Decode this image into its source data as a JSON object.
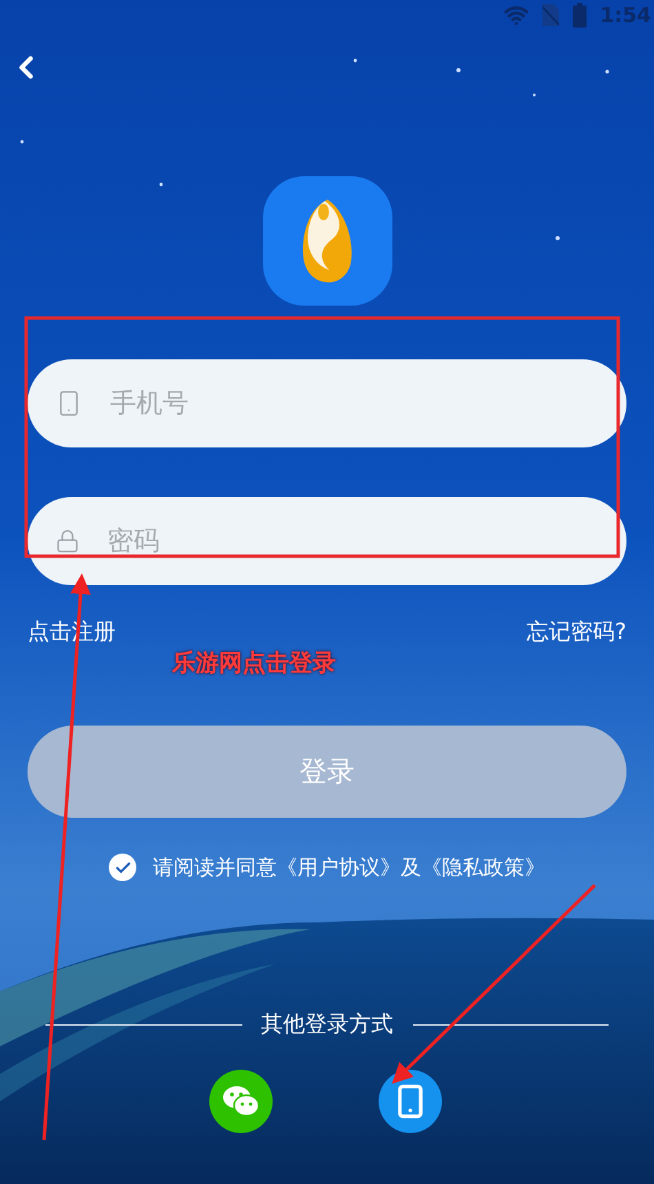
{
  "status_bar": {
    "time": "1:54"
  },
  "login_form": {
    "phone_field": {
      "placeholder": "手机号"
    },
    "password_field": {
      "placeholder": "密码"
    },
    "register_link": "点击注册",
    "forgot_link": "忘记密码?",
    "login_button": "登录",
    "agreement": {
      "checked": true,
      "text": "请阅读并同意《用户协议》及《隐私政策》"
    }
  },
  "annotation": {
    "text": "乐游网点击登录"
  },
  "other_login": {
    "label": "其他登录方式",
    "methods": [
      {
        "kind": "wechat"
      },
      {
        "kind": "phone"
      }
    ]
  }
}
